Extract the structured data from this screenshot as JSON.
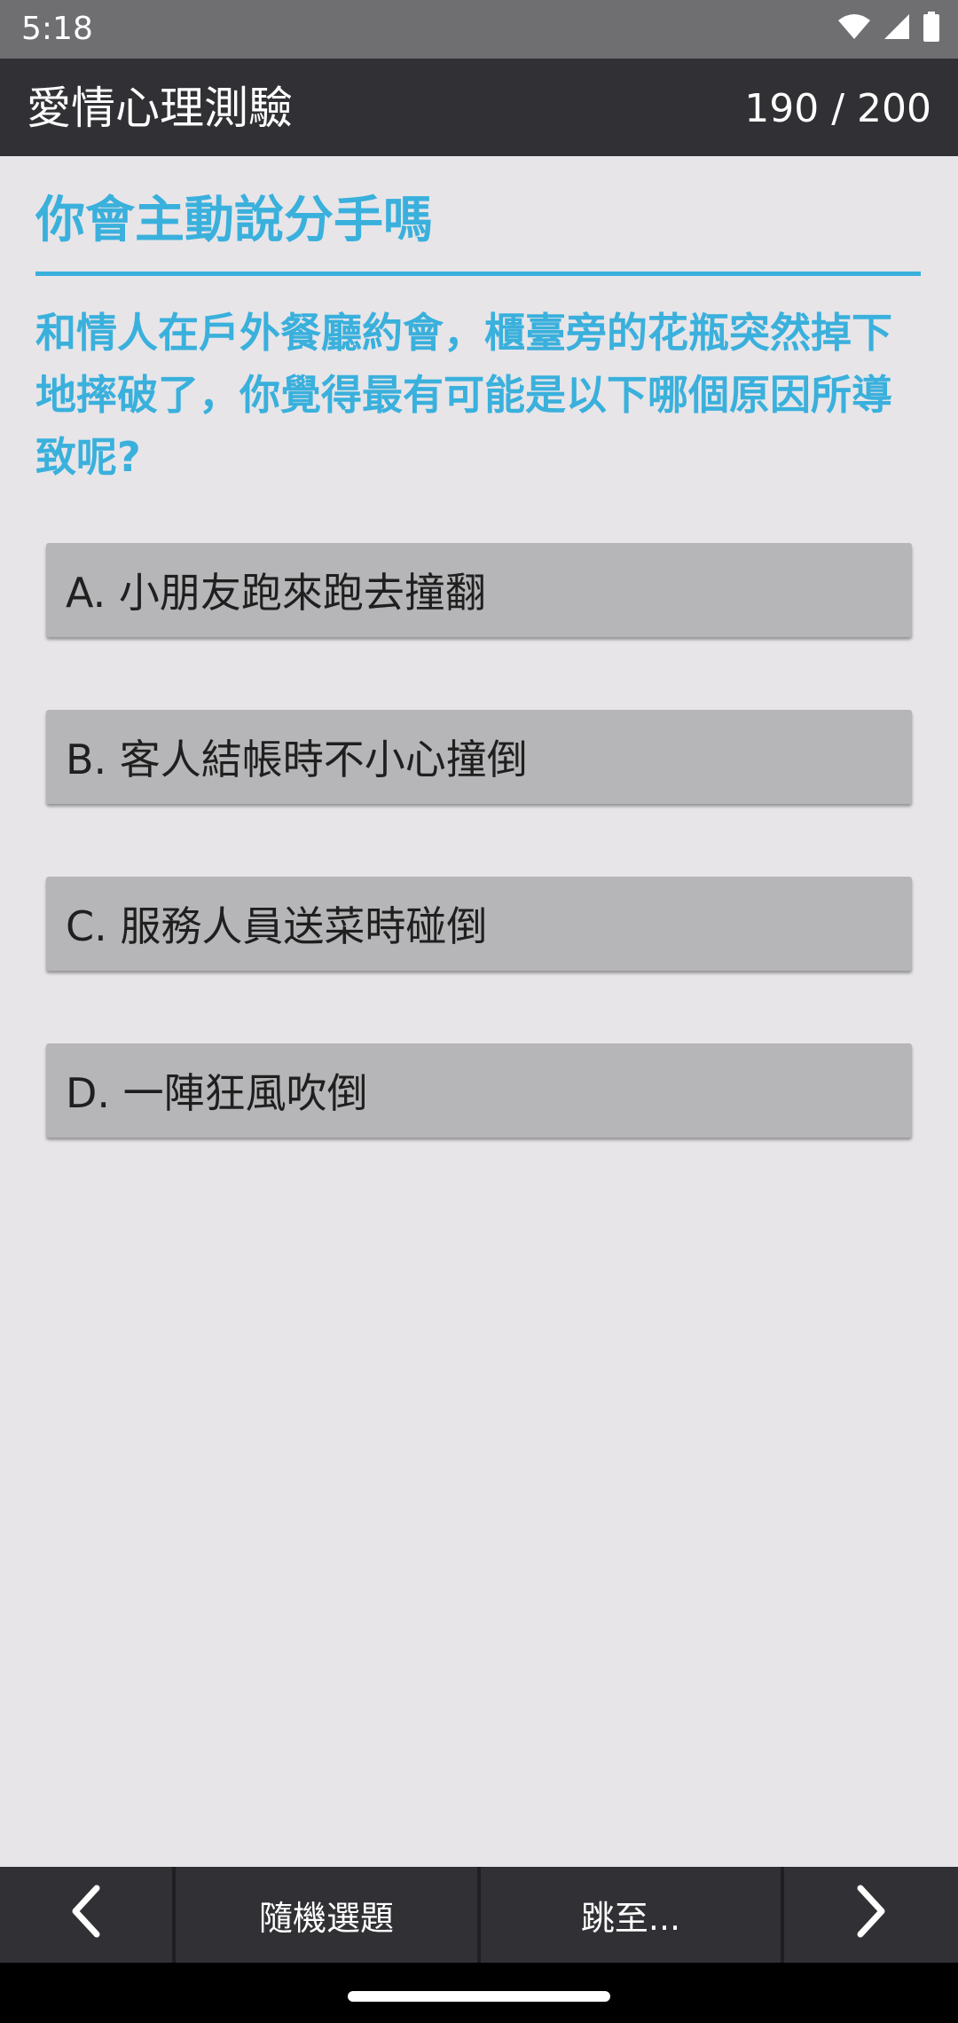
{
  "status_bar": {
    "time": "5:18"
  },
  "app_bar": {
    "title": "愛情心理測驗",
    "counter": "190 / 200"
  },
  "quiz": {
    "title": "你會主動說分手嗎",
    "question": "和情人在戶外餐廳約會，櫃臺旁的花瓶突然掉下地摔破了，你覺得最有可能是以下哪個原因所導致呢?",
    "options": [
      "A. 小朋友跑來跑去撞翻",
      "B. 客人結帳時不小心撞倒",
      "C. 服務人員送菜時碰倒",
      "D. 一陣狂風吹倒"
    ]
  },
  "bottom_bar": {
    "random_label": "隨機選題",
    "jump_label": "跳至..."
  },
  "icons": {
    "wifi": "wifi-icon",
    "signal": "signal-icon",
    "battery": "battery-icon",
    "prev": "chevron-left-icon",
    "next": "chevron-right-icon"
  },
  "colors": {
    "accent": "#3ab0dc",
    "app_bar": "#313034",
    "option_bg": "#b6b5b7",
    "background": "#e7e5e8"
  }
}
